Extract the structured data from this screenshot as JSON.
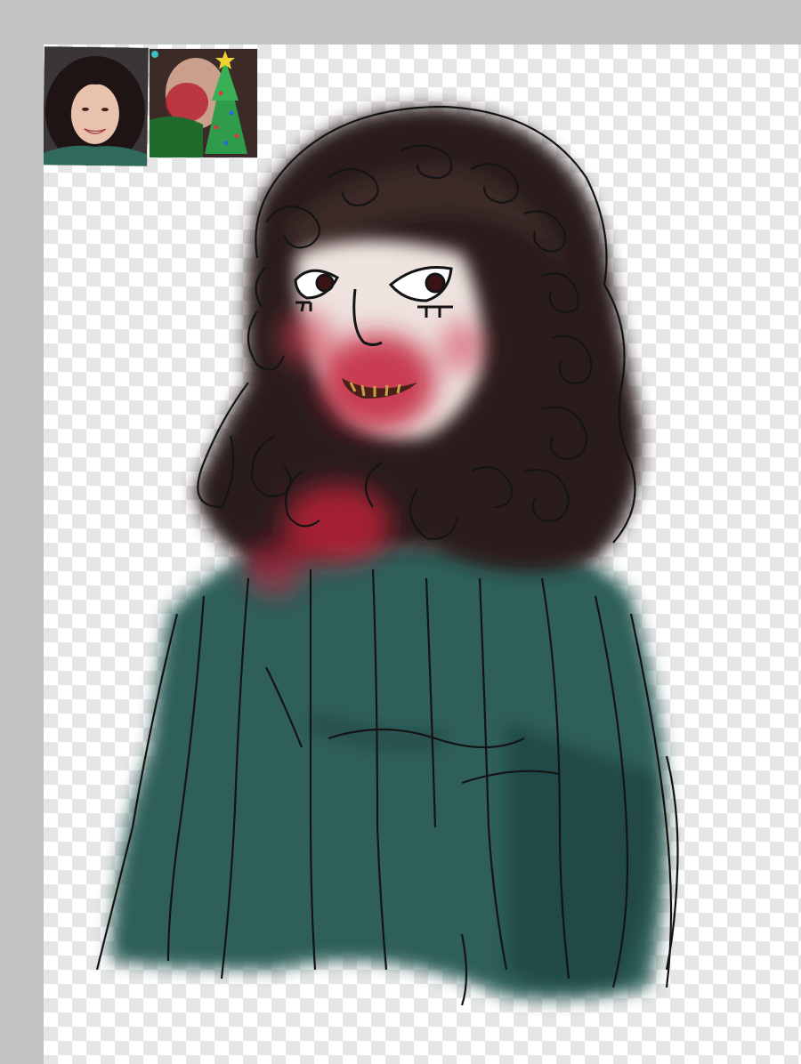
{
  "app": {
    "title": "",
    "canvas_background": "transparency-checkerboard"
  },
  "references": [
    {
      "name": "reference-photo-portrait",
      "description_icon": "photo-icon"
    },
    {
      "name": "reference-photo-christmas-edit",
      "description_icon": "photo-icon"
    }
  ],
  "artwork": {
    "subject": "digital-painting-character-bust",
    "palette": {
      "hair": "#2a1e1c",
      "sweater": "#2f5e5a",
      "blush": "#c21f3a",
      "skin": "#f0e6e2",
      "lineart": "#141414"
    }
  }
}
